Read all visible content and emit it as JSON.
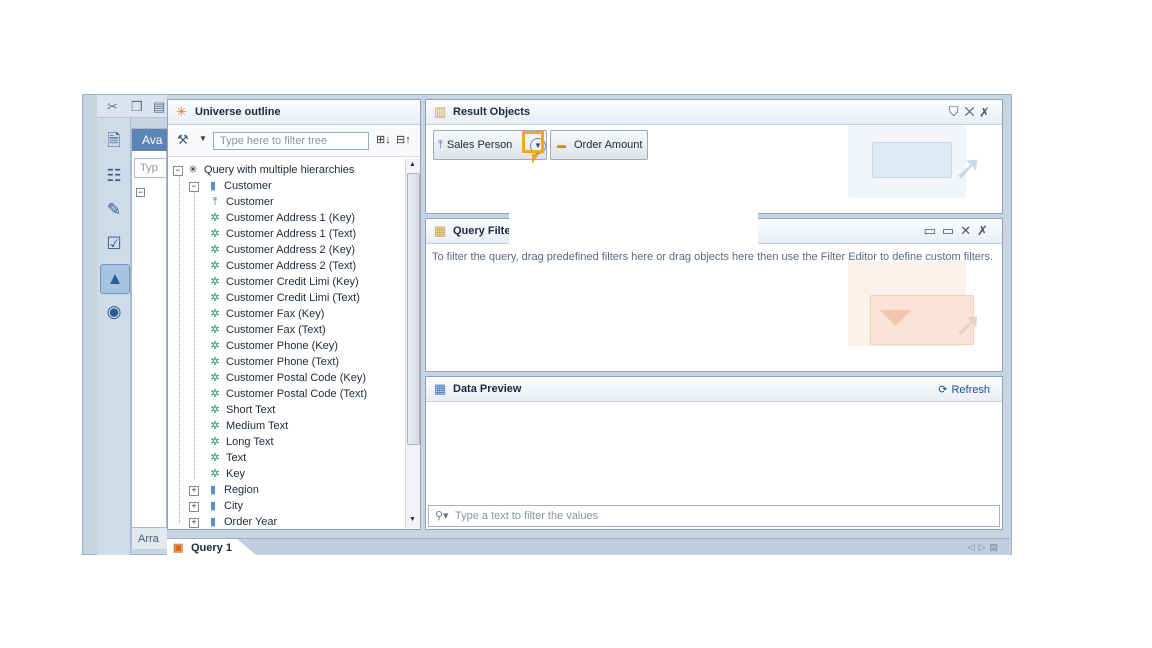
{
  "colors": {
    "accent": "#f5a623",
    "panel_border": "#8ea3bd",
    "link": "#1e4f8a"
  },
  "background": {
    "panel_tab": "Ava",
    "search_placeholder": "Typ",
    "bottom_tab": "Arra"
  },
  "universe": {
    "title": "Universe outline",
    "filter_placeholder": "Type here to filter tree",
    "root": "Query with multiple hierarchies",
    "group": "Customer",
    "items": [
      "Customer",
      "Customer Address 1 (Key)",
      "Customer Address 1 (Text)",
      "Customer Address 2 (Key)",
      "Customer Address 2 (Text)",
      "Customer Credit Limi (Key)",
      "Customer Credit Limi (Text)",
      "Customer Fax (Key)",
      "Customer Fax (Text)",
      "Customer Phone (Key)",
      "Customer Phone (Text)",
      "Customer Postal Code (Key)",
      "Customer Postal Code (Text)",
      "Short Text",
      "Medium Text",
      "Long Text",
      "Text",
      "Key"
    ],
    "other_groups": [
      "Region",
      "City",
      "Order Year"
    ]
  },
  "result": {
    "title": "Result Objects",
    "objects": [
      "Sales Person",
      "Order Amount"
    ]
  },
  "query_filters": {
    "title": "Query Filte",
    "hint": "To filter the query, drag predefined filters here or drag objects here then use the Filter Editor to define custom filters."
  },
  "preview": {
    "title": "Data Preview",
    "refresh": "Refresh",
    "filter_placeholder": "Type a text to filter the values"
  },
  "tabs": {
    "query": "Query 1"
  }
}
